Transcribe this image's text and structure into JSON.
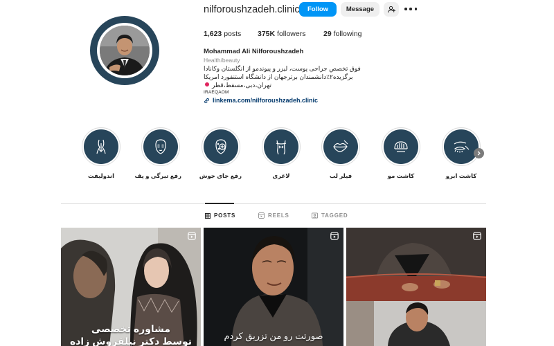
{
  "profile": {
    "username": "nilforoushzadeh.clinic",
    "follow_label": "Follow",
    "message_label": "Message",
    "stats": {
      "posts_count": "1,623",
      "posts_label": "posts",
      "followers_count": "375K",
      "followers_label": "followers",
      "following_count": "29",
      "following_label": "following"
    },
    "full_name": "Mohammad Ali Nilforoushzadeh",
    "category": "Health/beauty",
    "bio_line1": "فوق تخصص جراحی پوست، لیزر و پیوندمو از انگلستان وکانادا",
    "bio_line2": "برگزیده۲٪دانشمندان برترجهان از دانشگاه استنفورد امریکا",
    "bio_line3": "تهران،دبی،مسقط،قطر",
    "tag": "IRAEQAOM",
    "link": "linkema.com/nilforoushzadeh.clinic"
  },
  "highlights": [
    {
      "label": "اندولیفت",
      "icon": "endolift-icon"
    },
    {
      "label": "رفع تیرگی و پف",
      "icon": "face-dark-circles-icon"
    },
    {
      "label": "رفع جای جوش",
      "icon": "acne-scar-icon"
    },
    {
      "label": "لاغری",
      "icon": "body-slimming-icon"
    },
    {
      "label": "فیلر لب",
      "icon": "lip-filler-icon"
    },
    {
      "label": "کاشت مو",
      "icon": "hair-transplant-icon"
    },
    {
      "label": "کاشت ابرو",
      "icon": "eyebrow-transplant-icon"
    }
  ],
  "tabs": [
    {
      "label": "POSTS",
      "icon": "grid-icon",
      "active": true
    },
    {
      "label": "REELS",
      "icon": "reels-icon",
      "active": false
    },
    {
      "label": "TAGGED",
      "icon": "tagged-icon",
      "active": false
    }
  ],
  "posts": [
    {
      "caption_line1": "مشاوره تخصصی",
      "caption_line2": "توسط دکتر نیلفروش زاده",
      "type": "reel"
    },
    {
      "caption_line1": "صورتت رو من تزریق کردم",
      "type": "reel"
    },
    {
      "type": "reel"
    }
  ],
  "colors": {
    "accent": "#0095f6",
    "highlight_bg": "#27455a",
    "link": "#00376b"
  }
}
